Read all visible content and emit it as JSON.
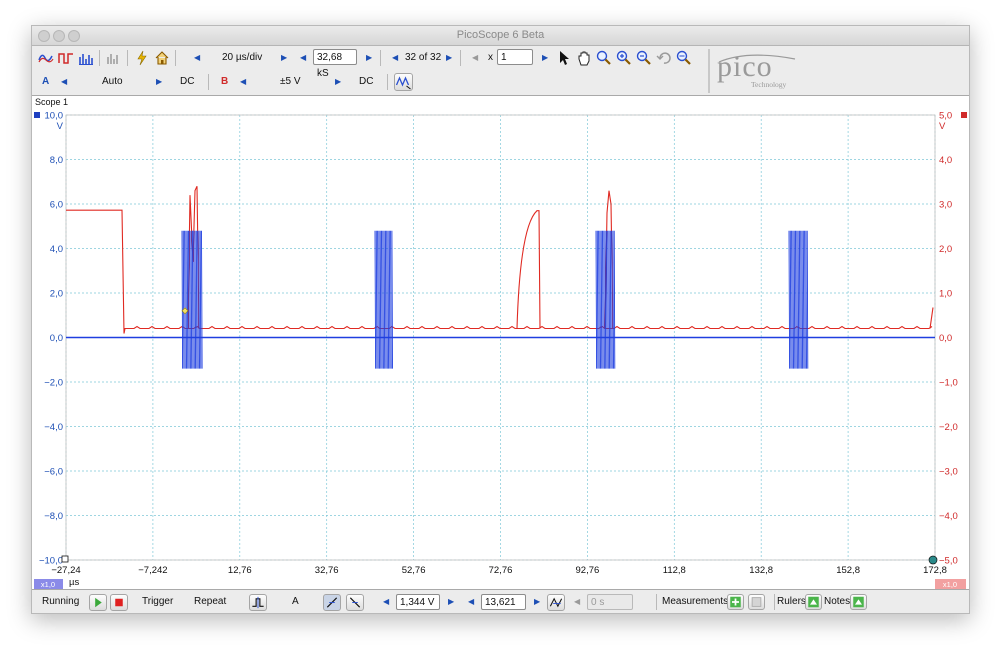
{
  "window": {
    "title": "PicoScope 6 Beta"
  },
  "toolbar1": {
    "timebase": "20 µs/div",
    "samples": "32,68 kS",
    "capture": "32 of 32",
    "zoom_prefix": "x",
    "zoom_value": "1"
  },
  "toolbar2": {
    "ch_a": {
      "label": "A",
      "mode": "Auto",
      "coupling": "DC"
    },
    "ch_b": {
      "label": "B",
      "range": "±5 V",
      "coupling": "DC"
    }
  },
  "logo": {
    "text": "pico",
    "sub": "Technology"
  },
  "scope": {
    "view_label": "Scope 1",
    "left_axis": {
      "unit": "V",
      "ticks": [
        "10,0",
        "8,0",
        "6,0",
        "4,0",
        "2,0",
        "0,0",
        "−2,0",
        "−4,0",
        "−6,0",
        "−8,0",
        "−10,0"
      ]
    },
    "right_axis": {
      "unit": "V",
      "ticks": [
        "5,0",
        "4,0",
        "3,0",
        "2,0",
        "1,0",
        "0,0",
        "−1,0",
        "−2,0",
        "−3,0",
        "−4,0",
        "−5,0"
      ]
    },
    "x_ticks": [
      "−27,24",
      "−7,242",
      "12,76",
      "32,76",
      "52,76",
      "72,76",
      "92,76",
      "112,8",
      "132,8",
      "152,8",
      "172,8"
    ],
    "x_unit": "µs",
    "zoom_badge_left": "x1,0",
    "zoom_badge_right": "x1,0",
    "colors": {
      "channel_a": "#1f3fe0",
      "channel_b": "#e02a22",
      "grid": "#7fc8d8"
    }
  },
  "statusbar": {
    "running": "Running",
    "trigger": "Trigger",
    "trigger_mode": "Repeat",
    "trigger_source": "A",
    "threshold": "1,344 V",
    "pretrigger": "13,621 %",
    "delay": "0 s",
    "measurements": "Measurements",
    "rulers": "Rulers",
    "notes": "Notes"
  }
}
